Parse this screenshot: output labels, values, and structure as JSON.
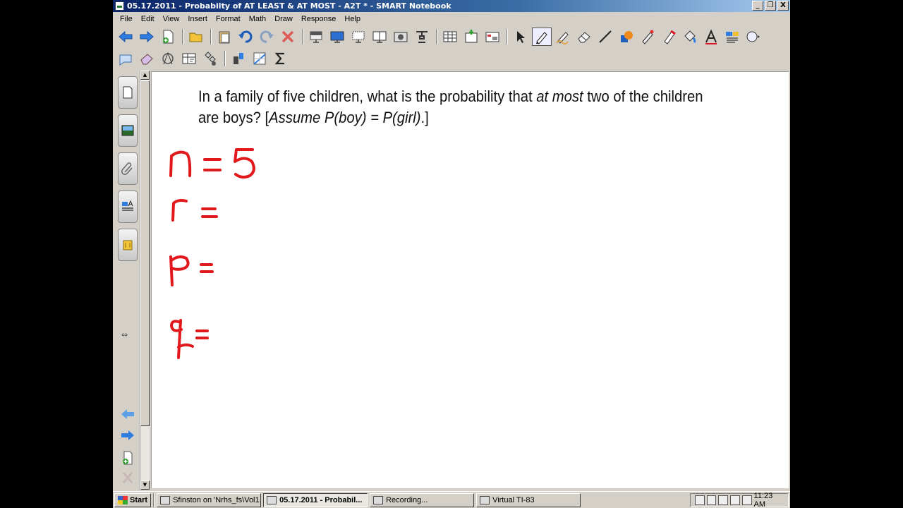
{
  "window": {
    "title": "05.17.2011 - Probabilty of AT LEAST & AT MOST - A2T * - SMART Notebook",
    "controls": {
      "minimize": "_",
      "restore": "❐",
      "close": "X"
    }
  },
  "menu": [
    "File",
    "Edit",
    "View",
    "Insert",
    "Format",
    "Math",
    "Draw",
    "Response",
    "Help"
  ],
  "toolbar_row1": [
    "back-arrow-icon",
    "forward-arrow-icon",
    "add-page-icon",
    "open-folder-icon",
    "paste-icon",
    "undo-icon",
    "redo-icon",
    "delete-icon",
    "screen-shade-icon",
    "full-screen-icon",
    "transparent-background-icon",
    "dual-page-icon",
    "screen-capture-icon",
    "document-camera-icon",
    "table-icon",
    "insert-question-icon",
    "response-icon",
    "select-icon",
    "pen-icon",
    "creative-pen-icon",
    "eraser-icon",
    "line-icon",
    "shapes-icon",
    "magic-pen-icon",
    "highlighter-icon",
    "fill-icon",
    "text-icon",
    "properties-icon",
    "more-icon"
  ],
  "toolbar_row2": [
    "move-toolbar-icon",
    "erase-ink-icon",
    "recognize-shape-icon",
    "math-table-icon",
    "link-icon",
    "attachment-icon",
    "graph-icon",
    "sigma-icon"
  ],
  "side_tabs": [
    "page-sorter-icon",
    "gallery-icon",
    "attachments-icon",
    "properties-icon",
    "addons-icon"
  ],
  "canvas": {
    "question_line1_a": "In a family of five children, what is the probability that ",
    "question_line1_em": "at most",
    "question_line1_b": " two of the children",
    "question_line2_a": "are boys? [",
    "question_line2_em": "Assume P(boy) = P(girl)",
    "question_line2_b": ".]"
  },
  "taskbar": {
    "start": "Start",
    "tasks": [
      {
        "label": "Sfinston on 'Nrhs_fs\\Vol1...",
        "active": false
      },
      {
        "label": "05.17.2011 - Probabil...",
        "active": true
      },
      {
        "label": "Recording...",
        "active": false
      },
      {
        "label": "Virtual TI-83",
        "active": false
      }
    ],
    "clock": "11:23 AM"
  }
}
